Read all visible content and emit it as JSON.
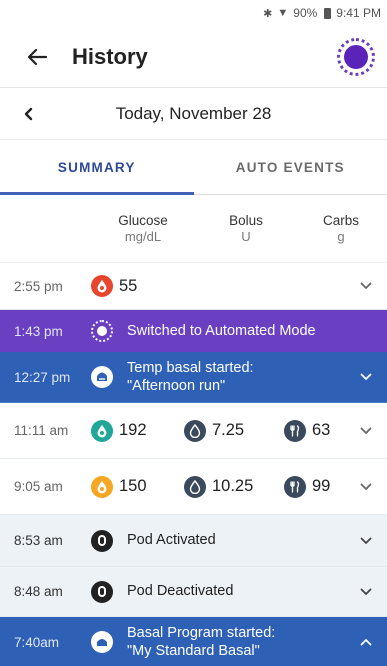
{
  "status_bar": {
    "battery": "90%",
    "time": "9:41 PM"
  },
  "header": {
    "title": "History"
  },
  "date_nav": {
    "label": "Today, November 28"
  },
  "tabs": [
    {
      "label": "SUMMARY",
      "active": true
    },
    {
      "label": "AUTO EVENTS",
      "active": false
    }
  ],
  "columns": {
    "glucose": {
      "title": "Glucose",
      "unit": "mg/dL"
    },
    "bolus": {
      "title": "Bolus",
      "unit": "U"
    },
    "carbs": {
      "title": "Carbs",
      "unit": "g"
    }
  },
  "rows": [
    {
      "time": "2:55 pm",
      "glucose": "55",
      "glucose_color": "#e8452f",
      "style": "white"
    },
    {
      "time": "1:43 pm",
      "event": "Switched to Automated Mode",
      "style": "purple"
    },
    {
      "time": "12:27 pm",
      "event_line1": "Temp basal started:",
      "event_line2": "\"Afternoon run\"",
      "style": "blue"
    },
    {
      "time": "11:11 am",
      "glucose": "192",
      "glucose_color": "#20a79a",
      "bolus": "7.25",
      "carbs": "63",
      "style": "white"
    },
    {
      "time": "9:05 am",
      "glucose": "150",
      "glucose_color": "#f5a623",
      "bolus": "10.25",
      "carbs": "99",
      "style": "white"
    },
    {
      "time": "8:53 am",
      "event": "Pod Activated",
      "style": "light"
    },
    {
      "time": "8:48 am",
      "event": "Pod Deactivated",
      "style": "light"
    },
    {
      "time": "7:40am",
      "event_line1": "Basal Program started:",
      "event_line2": "\"My Standard Basal\"",
      "style": "blue"
    }
  ],
  "colors": {
    "accent_purple": "#6a3fc2",
    "accent_blue": "#2e61b6",
    "tab_active": "#2d4a96",
    "low_glucose": "#e8452f",
    "in_range_glucose": "#20a79a",
    "high_glucose": "#f5a623",
    "icon_dark": "#3a4a5c"
  }
}
